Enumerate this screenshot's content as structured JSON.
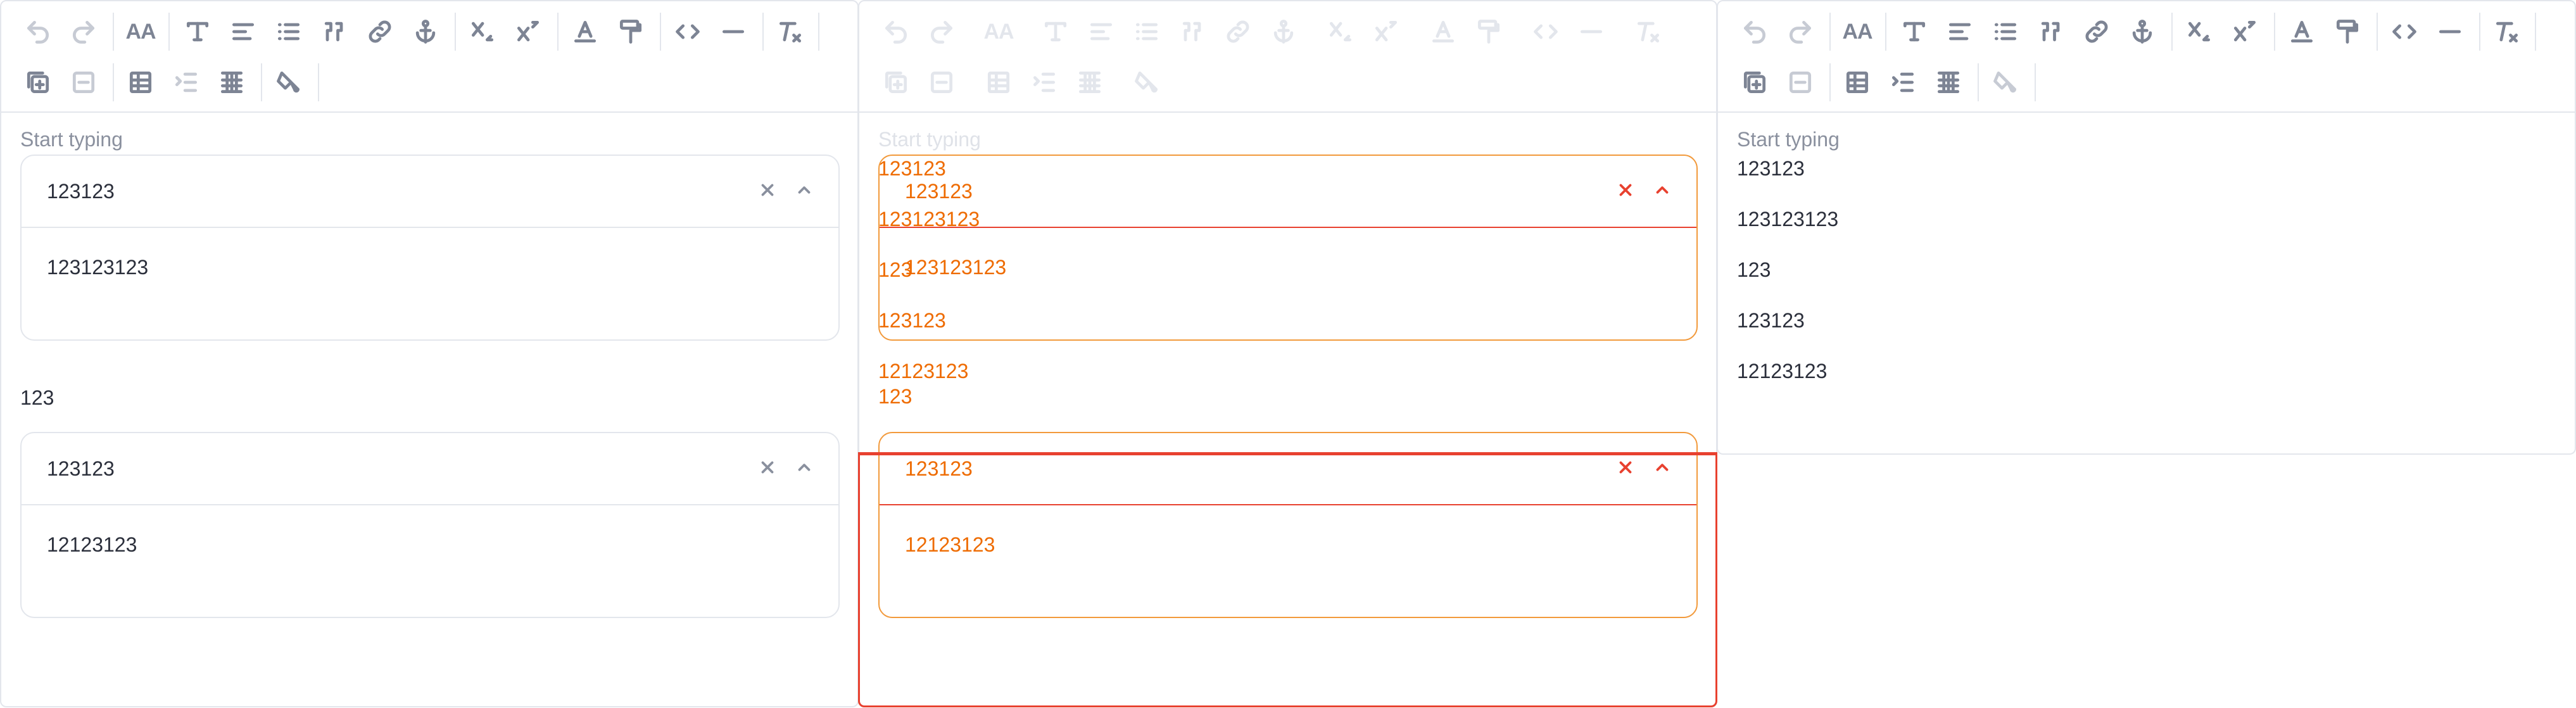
{
  "colors": {
    "border": "#e3e6ec",
    "text": "#2b2f3b",
    "muted": "#8a909e",
    "diff_orange": "#ee6b00",
    "diff_red": "#e8412f"
  },
  "toolbar": {
    "row1_icons": [
      "undo-icon",
      "redo-icon",
      "font-size-icon",
      "paragraph-format-icon",
      "align-icon",
      "bullet-list-icon",
      "blockquote-icon",
      "link-icon",
      "anchor-icon",
      "subscript-icon",
      "superscript-icon",
      "text-color-icon",
      "paint-format-icon",
      "code-icon",
      "horizontal-rule-icon",
      "clear-format-icon"
    ],
    "row2_icons": [
      "add-row-icon",
      "remove-row-icon",
      "table-icon",
      "indent-icon",
      "grid-icon",
      "fill-color-icon"
    ]
  },
  "left": {
    "placeholder": "Start typing",
    "select1": {
      "value": "123123",
      "option": "123123123"
    },
    "paragraph": "123",
    "select2": {
      "value": "123123",
      "option": "12123123"
    }
  },
  "middle": {
    "placeholder": "Start typing",
    "overlay_lines": [
      "123123",
      "123123123",
      "123",
      "123123",
      "12123123",
      "123"
    ],
    "select1": {
      "value": "123123",
      "option": "123123123"
    },
    "select2": {
      "value": "123123",
      "option": "12123123"
    }
  },
  "right": {
    "placeholder": "Start typing",
    "lines": [
      "123123",
      "123123123",
      "123",
      "123123",
      "12123123"
    ]
  }
}
